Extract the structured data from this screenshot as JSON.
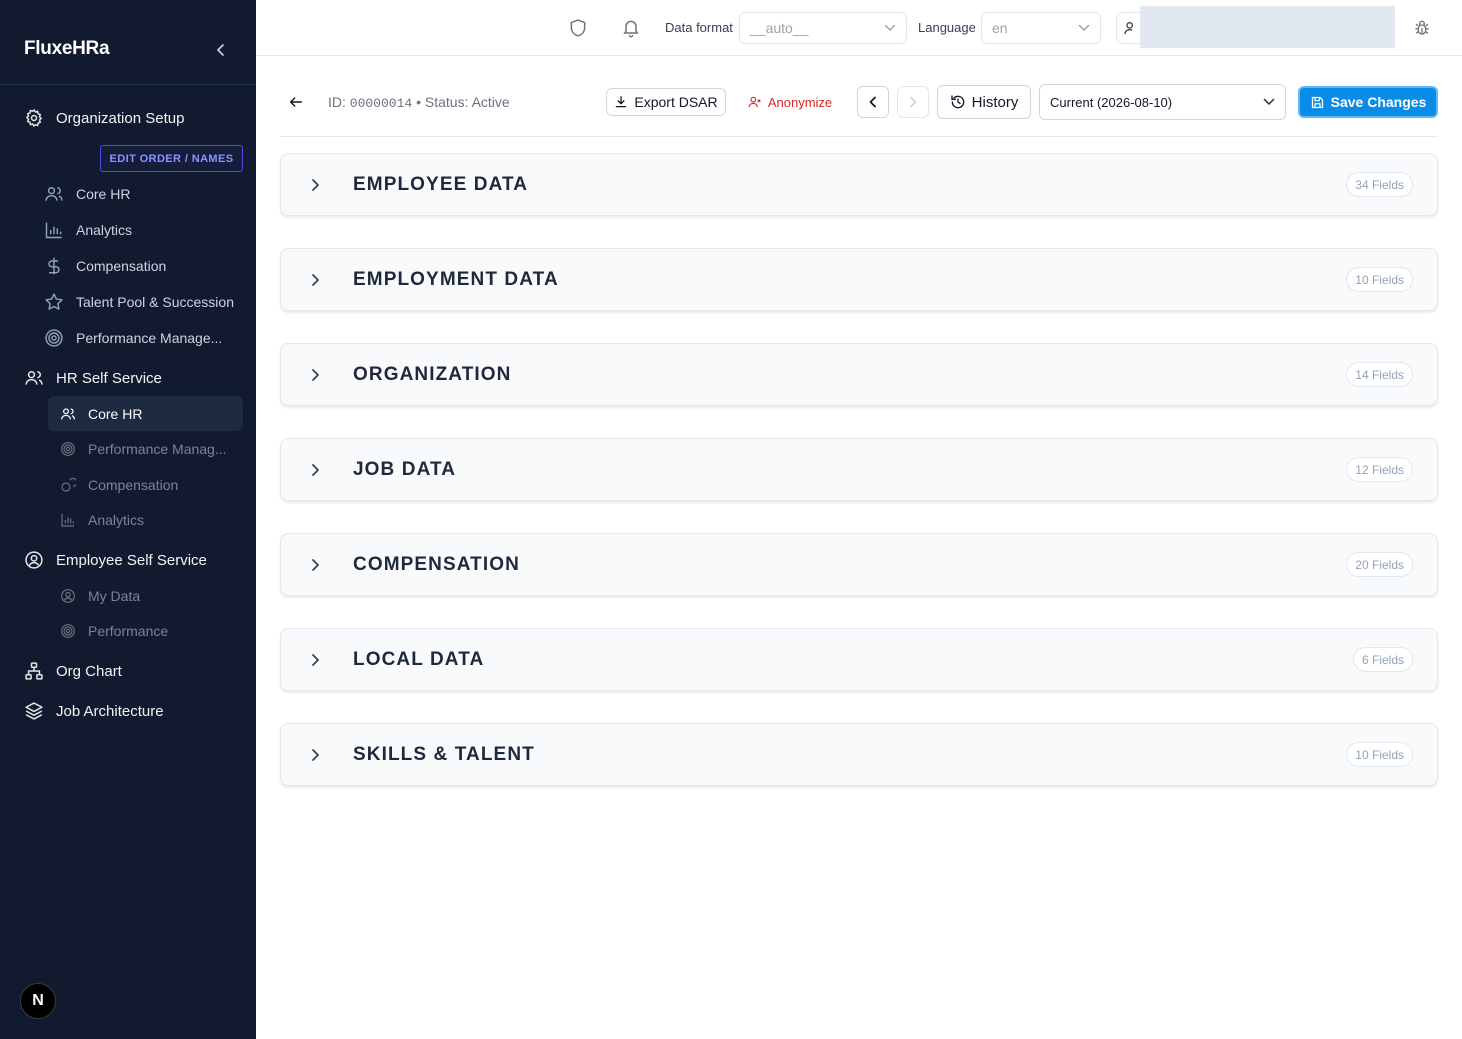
{
  "app": {
    "brand": "FluxeHRa"
  },
  "sidebar": {
    "organization_setup": "Organization Setup",
    "edit_order": "EDIT ORDER / NAMES",
    "org_items": [
      {
        "label": "Core HR",
        "icon": "users-icon"
      },
      {
        "label": "Analytics",
        "icon": "bar-chart-icon"
      },
      {
        "label": "Compensation",
        "icon": "dollar-icon"
      },
      {
        "label": "Talent Pool & Succession",
        "icon": "star-icon"
      },
      {
        "label": "Performance Manage...",
        "icon": "target-icon"
      }
    ],
    "hr_self_service": "HR Self Service",
    "hr_items": [
      {
        "label": "Core HR",
        "icon": "users-icon",
        "active": true
      },
      {
        "label": "Performance Manag...",
        "icon": "target-icon"
      },
      {
        "label": "Compensation",
        "icon": "coins-icon"
      },
      {
        "label": "Analytics",
        "icon": "bar-chart-icon"
      }
    ],
    "employee_self_service": "Employee Self Service",
    "ess_items": [
      {
        "label": "My Data",
        "icon": "user-circle-icon"
      },
      {
        "label": "Performance",
        "icon": "target-icon"
      }
    ],
    "org_chart": "Org Chart",
    "job_architecture": "Job Architecture",
    "badge": "N"
  },
  "topbar": {
    "data_format_label": "Data format",
    "data_format_value": "__auto__",
    "language_label": "Language",
    "language_value": "en"
  },
  "toolbar": {
    "id_prefix": "ID:",
    "id_value": "00000014",
    "status": "• Status: Active",
    "export": "Export DSAR",
    "anonymize": "Anonymize",
    "history": "History",
    "version": "Current (2026-08-10)",
    "save": "Save Changes"
  },
  "sections": [
    {
      "title": "EMPLOYEE DATA",
      "count": "34 Fields"
    },
    {
      "title": "EMPLOYMENT DATA",
      "count": "10 Fields"
    },
    {
      "title": "ORGANIZATION",
      "count": "14 Fields"
    },
    {
      "title": "JOB DATA",
      "count": "12 Fields"
    },
    {
      "title": "COMPENSATION",
      "count": "20 Fields"
    },
    {
      "title": "LOCAL DATA",
      "count": "6 Fields"
    },
    {
      "title": "SKILLS & TALENT",
      "count": "10 Fields"
    }
  ],
  "colors": {
    "sidebar_bg": "#111a2e",
    "primary": "#0b8be8",
    "danger": "#dc2626",
    "accent": "#4f46e5"
  }
}
